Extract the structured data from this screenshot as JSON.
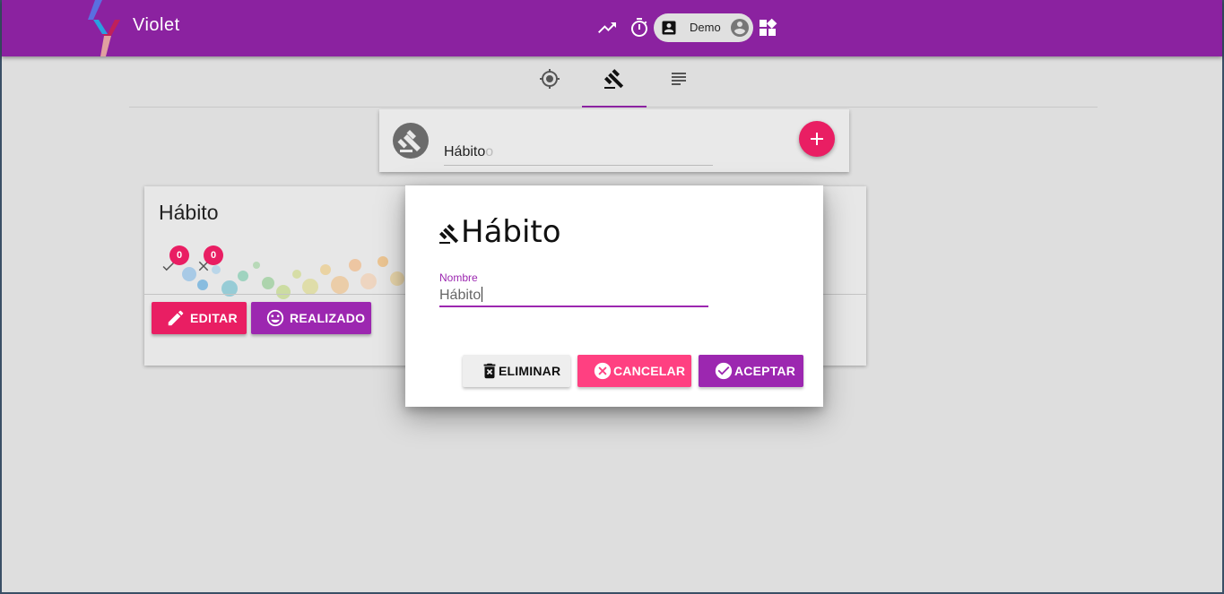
{
  "app": {
    "title": "Violet",
    "user_label": "Demo"
  },
  "header_icons": [
    "trending-up-icon",
    "timer-icon",
    "contact-badge-icon",
    "account-circle-icon",
    "widgets-icon"
  ],
  "tabs": [
    {
      "icon": "target-icon",
      "active": false
    },
    {
      "icon": "gavel-icon",
      "active": true
    },
    {
      "icon": "notes-icon",
      "active": false
    }
  ],
  "add_bar": {
    "input_value": "Hábito",
    "input_ghost": "o"
  },
  "habit_card": {
    "title": "Hábito",
    "done_count": "0",
    "failed_count": "0",
    "edit_label": "EDITAR",
    "done_label": "REALIZADO"
  },
  "dialog": {
    "title": "Hábito",
    "field_label": "Nombre",
    "field_value": "Hábito",
    "delete_label": "ELIMINAR",
    "cancel_label": "CANCELAR",
    "accept_label": "ACEPTAR"
  },
  "colors": {
    "primary": "#8b22a0",
    "accent_pink": "#e91e63",
    "button_purple": "#9c27b0",
    "cancel_pink": "#ff4081",
    "background": "#dedede"
  }
}
